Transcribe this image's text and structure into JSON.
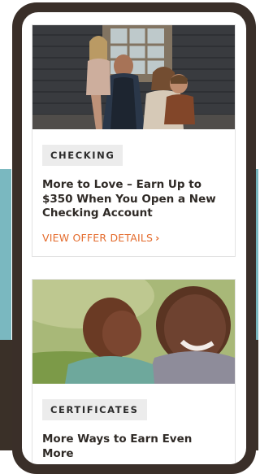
{
  "cards": [
    {
      "tag": "CHECKING",
      "headline": "More to Love  – Earn Up to $350 When You Open a New Checking Account",
      "cta": "VIEW OFFER DETAILS",
      "cta_icon": "chevron-right-icon"
    },
    {
      "tag": "CERTIFICATES",
      "headline": "More Ways to Earn Even More"
    }
  ],
  "colors": {
    "accent": "#e46b2c",
    "phone_frame": "#3a2f29",
    "tag_bg": "#ececec",
    "teal": "#7ab8c0"
  }
}
